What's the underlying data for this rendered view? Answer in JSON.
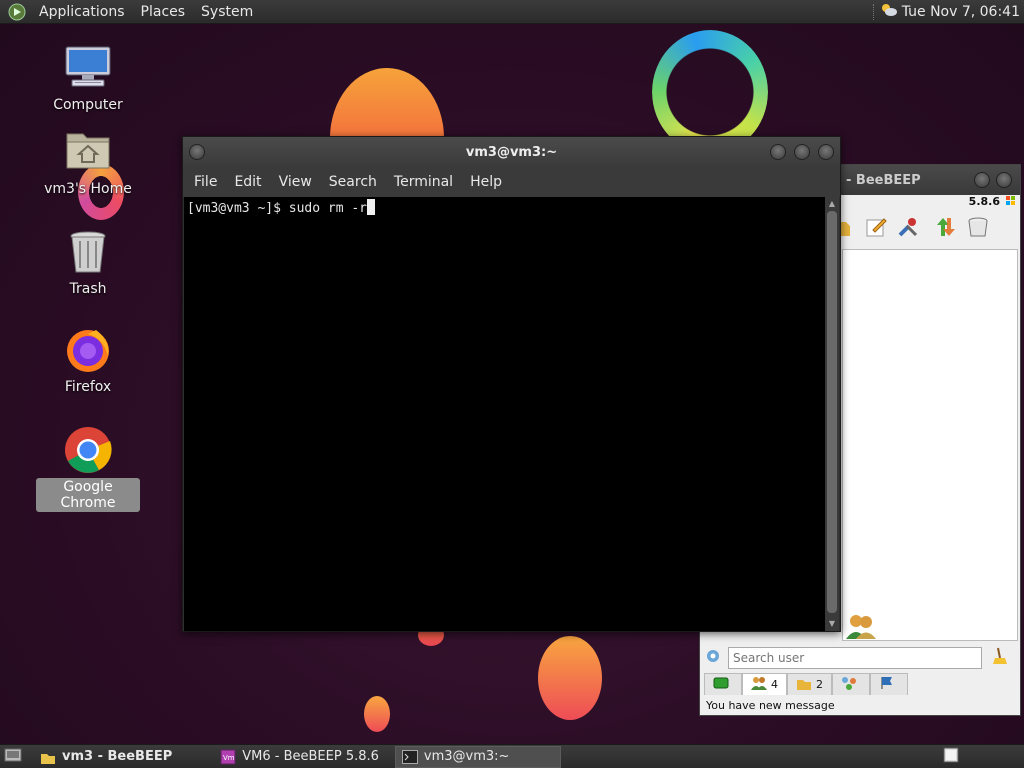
{
  "top_panel": {
    "menus": [
      "Applications",
      "Places",
      "System"
    ],
    "clock": "Tue Nov 7, 06:41"
  },
  "desktop": {
    "icons": [
      {
        "label": "Computer",
        "icon": "computer-icon"
      },
      {
        "label": "vm3's Home",
        "icon": "home-folder-icon"
      },
      {
        "label": "Trash",
        "icon": "trash-icon"
      },
      {
        "label": "Firefox",
        "icon": "firefox-icon"
      },
      {
        "label": "Google Chrome",
        "icon": "chrome-icon",
        "selected": true
      }
    ]
  },
  "terminal": {
    "title": "vm3@vm3:~",
    "menus": [
      "File",
      "Edit",
      "View",
      "Search",
      "Terminal",
      "Help"
    ],
    "prompt": "[vm3@vm3 ~]$ sudo rm -r"
  },
  "beebeep": {
    "title": "- BeeBEEP",
    "version": "5.8.6",
    "search_placeholder": "Search user",
    "tabs": [
      {
        "icon": "chat-icon",
        "count": ""
      },
      {
        "icon": "users-icon",
        "count": "4"
      },
      {
        "icon": "groups-icon",
        "count": "2"
      },
      {
        "icon": "network-icon",
        "count": ""
      },
      {
        "icon": "flag-icon",
        "count": ""
      }
    ],
    "status": "You have new message"
  },
  "bottom_panel": {
    "tasks": [
      {
        "label": "vm3 - BeeBEEP",
        "icon": "beebeep-icon",
        "bold": true
      },
      {
        "label": "VM6 - BeeBEEP 5.8.6",
        "icon": "vm-icon"
      },
      {
        "label": "vm3@vm3:~",
        "icon": "terminal-icon",
        "active": true
      }
    ]
  },
  "colors": {
    "panel": "#2f2f2f",
    "desktop_bg": "#2a0f24",
    "terminal_bg": "#000000"
  }
}
